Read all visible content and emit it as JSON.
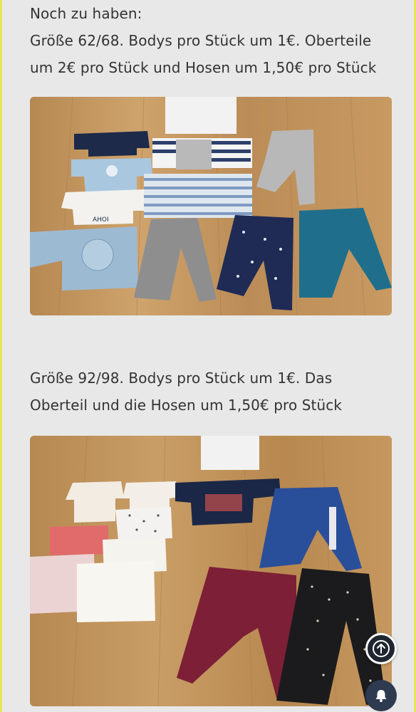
{
  "post": {
    "line1": "Noch zu haben:",
    "line2": "Größe 62/68. Bodys pro Stück um 1€. Oberteile",
    "line3": "um 2€ pro Stück und Hosen um 1,50€ pro Stück",
    "line4": "Größe 92/98. Bodys pro Stück um 1€. Das",
    "line5": "Oberteil und die Hosen um 1,50€ pro Stück"
  },
  "photos": [
    {
      "caption": "Baby clothes size 62/68 laid on wooden floor"
    },
    {
      "caption": "Kids clothes size 92/98 laid on wooden floor"
    }
  ],
  "controls": {
    "scroll_top_icon": "arrow-up-icon",
    "notification_icon": "bell-icon"
  },
  "colors": {
    "border_accent": "#e3e45a",
    "fab_bg": "#1f2630"
  }
}
